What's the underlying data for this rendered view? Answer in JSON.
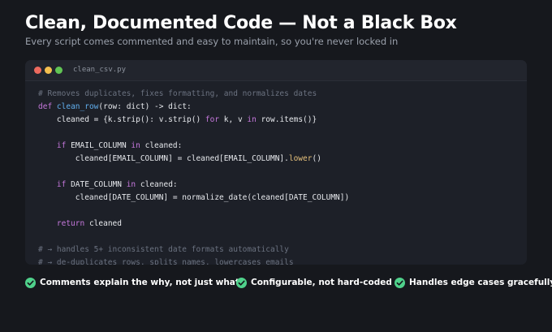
{
  "header": {
    "title": "Clean, Documented Code — Not a Black Box",
    "subtitle": "Every script comes commented and easy to maintain, so you're never locked in"
  },
  "editor": {
    "filename": "clean_csv.py",
    "colors": {
      "comment": "#6b7280",
      "keyword": "#c678dd",
      "function": "#61afef",
      "method": "#e5c07b"
    },
    "lines": [
      [
        {
          "t": "# Removes duplicates, fixes formatting, and normalizes dates",
          "c": "cm"
        }
      ],
      [
        {
          "t": "def",
          "c": "kw"
        },
        {
          "t": " "
        },
        {
          "t": "clean_row",
          "c": "fn"
        },
        {
          "t": "(row: dict) -> dict:"
        }
      ],
      [
        {
          "t": "    cleaned = {k.strip(): v.strip() "
        },
        {
          "t": "for",
          "c": "kw"
        },
        {
          "t": " k, v "
        },
        {
          "t": "in",
          "c": "kw"
        },
        {
          "t": " row.items()}"
        }
      ],
      [],
      [
        {
          "t": "    "
        },
        {
          "t": "if",
          "c": "kw"
        },
        {
          "t": " EMAIL_COLUMN "
        },
        {
          "t": "in",
          "c": "kw"
        },
        {
          "t": " cleaned:"
        }
      ],
      [
        {
          "t": "        cleaned[EMAIL_COLUMN] = cleaned[EMAIL_COLUMN]."
        },
        {
          "t": "lower",
          "c": "mt"
        },
        {
          "t": "()"
        }
      ],
      [],
      [
        {
          "t": "    "
        },
        {
          "t": "if",
          "c": "kw"
        },
        {
          "t": " DATE_COLUMN "
        },
        {
          "t": "in",
          "c": "kw"
        },
        {
          "t": " cleaned:"
        }
      ],
      [
        {
          "t": "        cleaned[DATE_COLUMN] = normalize_date(cleaned[DATE_COLUMN])"
        }
      ],
      [],
      [
        {
          "t": "    "
        },
        {
          "t": "return",
          "c": "kw"
        },
        {
          "t": " cleaned"
        }
      ],
      [],
      [
        {
          "t": "# → handles 5+ inconsistent date formats automatically",
          "c": "cm"
        }
      ],
      [
        {
          "t": "# → de-duplicates rows, splits names, lowercases emails",
          "c": "cm"
        }
      ]
    ]
  },
  "features": [
    {
      "label": "Comments explain the why, not just what",
      "icon": "check-circle-icon"
    },
    {
      "label": "Configurable, not hard-coded",
      "icon": "check-circle-icon"
    },
    {
      "label": "Handles edge cases gracefully",
      "icon": "check-circle-icon"
    }
  ],
  "colors": {
    "background": "#16181d",
    "panel": "#1d2028",
    "accent_check": "#4fd18b"
  }
}
